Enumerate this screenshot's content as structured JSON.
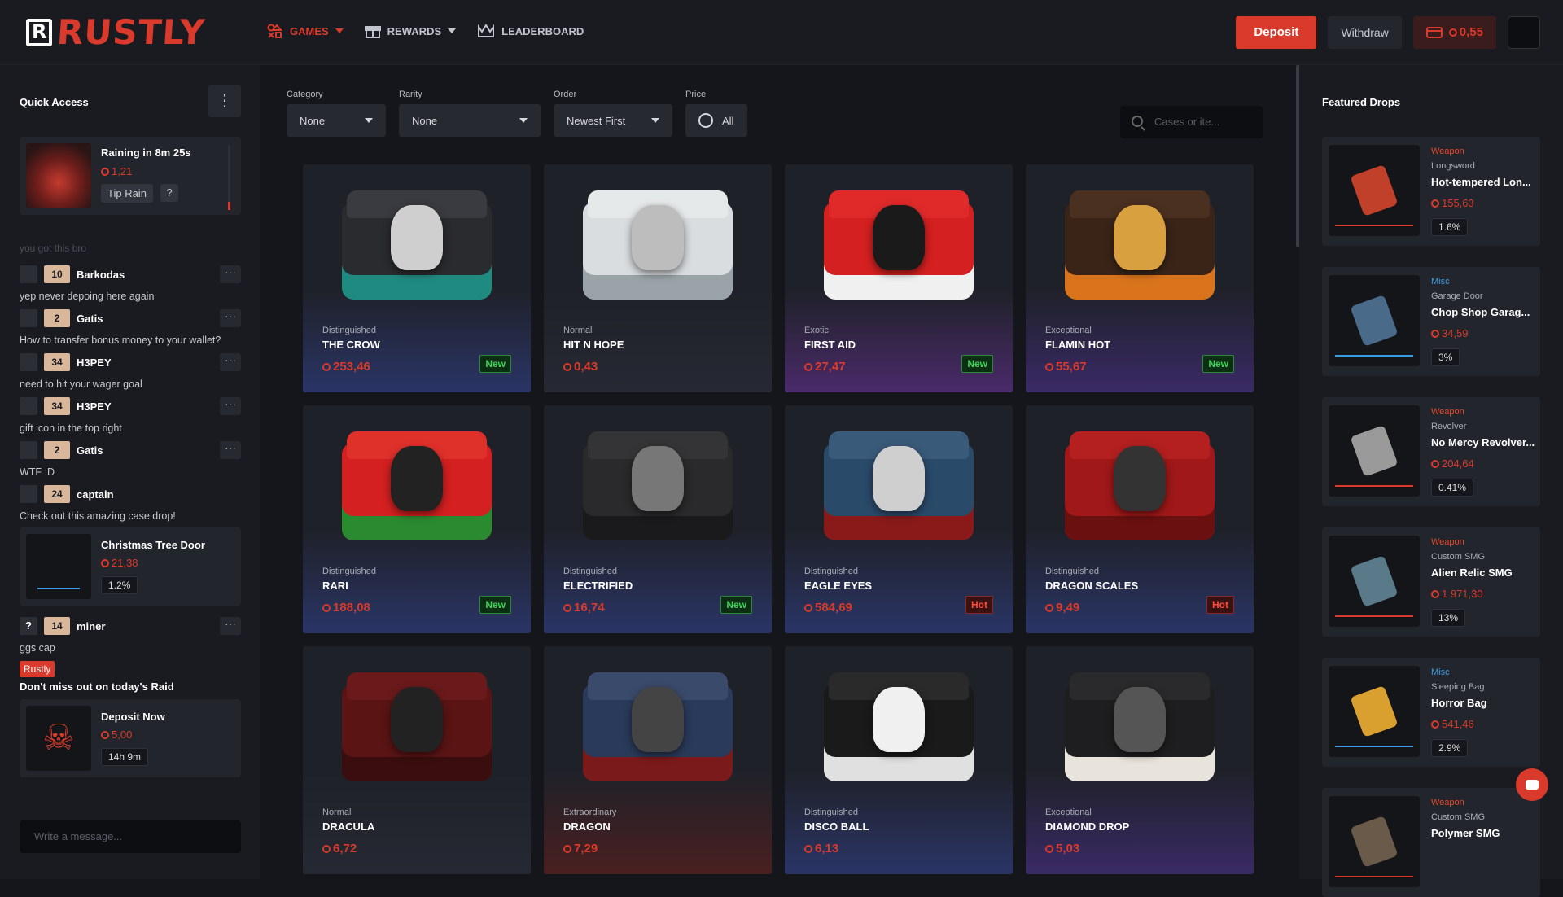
{
  "header": {
    "logo": "RUSTLY",
    "nav": [
      {
        "label": "GAMES",
        "icon": "games-icon"
      },
      {
        "label": "REWARDS",
        "icon": "gift-icon"
      },
      {
        "label": "LEADERBOARD",
        "icon": "crown-icon"
      }
    ],
    "deposit": "Deposit",
    "withdraw": "Withdraw",
    "balance": "0,55"
  },
  "sidebar": {
    "title": "Quick Access",
    "rain": {
      "title": "Raining in 8m 25s",
      "amount": "1,21",
      "tip": "Tip Rain",
      "help": "?"
    },
    "faded": "you got this bro",
    "messages": [
      {
        "user": "Barkodas",
        "level": "10",
        "text": "yep never depoing here again"
      },
      {
        "user": "Gatis",
        "level": "2",
        "text": "How to transfer bonus money to your wallet?"
      },
      {
        "user": "H3PEY",
        "level": "34",
        "text": "need to hit your wager goal"
      },
      {
        "user": "H3PEY",
        "level": "34",
        "text": "gift icon in the top right"
      },
      {
        "user": "Gatis",
        "level": "2",
        "text": "WTF :D"
      },
      {
        "user": "captain",
        "level": "24",
        "text": "Check out this amazing case drop!"
      }
    ],
    "share": {
      "title": "Christmas Tree Door",
      "amount": "21,38",
      "chance": "1.2%"
    },
    "miner": {
      "avatar": "?",
      "user": "miner",
      "level": "14",
      "text": "ggs cap"
    },
    "rustly_tag": "Rustly",
    "raid_title": "Don't miss out on today's Raid",
    "raid": {
      "title": "Deposit Now",
      "amount": "5,00",
      "timer": "14h 9m"
    },
    "input_placeholder": "Write a message..."
  },
  "filters": {
    "category": {
      "label": "Category",
      "value": "None"
    },
    "rarity": {
      "label": "Rarity",
      "value": "None"
    },
    "order": {
      "label": "Order",
      "value": "Newest First"
    },
    "price": {
      "label": "Price",
      "value": "All"
    },
    "search_placeholder": "Cases or ite..."
  },
  "cases": [
    {
      "rarity": "Distinguished",
      "name": "THE CROW",
      "price": "253,46",
      "badge": "New",
      "tint": "#2a3566",
      "body": "#2a2b2f",
      "band": "#1e8a80",
      "lid": "#3a3b40",
      "icon": "#cfcfcf"
    },
    {
      "rarity": "Normal",
      "name": "HIT N HOPE",
      "price": "0,43",
      "badge": "",
      "tint": "#262933",
      "body": "#d9dde0",
      "band": "#9aa3a8",
      "lid": "#e6e9ea",
      "icon": "#bdbdbd"
    },
    {
      "rarity": "Exotic",
      "name": "FIRST AID",
      "price": "27,47",
      "badge": "New",
      "tint": "#4a2a6a",
      "body": "#d42020",
      "band": "#f0f0f0",
      "lid": "#e02a2a",
      "icon": "#1a1a1a"
    },
    {
      "rarity": "Exceptional",
      "name": "FLAMIN HOT",
      "price": "55,67",
      "badge": "New",
      "tint": "#3a2a66",
      "body": "#3a2418",
      "band": "#d9741c",
      "lid": "#4a3020",
      "icon": "#d9a040"
    },
    {
      "rarity": "Distinguished",
      "name": "RARI",
      "price": "188,08",
      "badge": "New",
      "tint": "#2a3566",
      "body": "#d42020",
      "band": "#2a8a30",
      "lid": "#e0302a",
      "icon": "#222"
    },
    {
      "rarity": "Distinguished",
      "name": "ELECTRIFIED",
      "price": "16,74",
      "badge": "New",
      "tint": "#2a3566",
      "body": "#2a2a2c",
      "band": "#1a1a1c",
      "lid": "#343436",
      "icon": "#777"
    },
    {
      "rarity": "Distinguished",
      "name": "EAGLE EYES",
      "price": "584,69",
      "badge": "Hot",
      "tint": "#2a3566",
      "body": "#2a4a6a",
      "band": "#8a1a1a",
      "lid": "#3a5a7a",
      "icon": "#cfcfcf"
    },
    {
      "rarity": "Distinguished",
      "name": "DRAGON SCALES",
      "price": "9,49",
      "badge": "Hot",
      "tint": "#2a3566",
      "body": "#a01818",
      "band": "#6a1010",
      "lid": "#b42020",
      "icon": "#333"
    },
    {
      "rarity": "Normal",
      "name": "DRACULA",
      "price": "6,72",
      "badge": "",
      "tint": "#262933",
      "body": "#5a1414",
      "band": "#3a0e0e",
      "lid": "#6a1a1a",
      "icon": "#222"
    },
    {
      "rarity": "Extraordinary",
      "name": "DRAGON",
      "price": "7,29",
      "badge": "",
      "tint": "#4a2020",
      "body": "#2a3a5a",
      "band": "#7a1a1a",
      "lid": "#3a4a6a",
      "icon": "#444"
    },
    {
      "rarity": "Distinguished",
      "name": "DISCO BALL",
      "price": "6,13",
      "badge": "",
      "tint": "#2a3566",
      "body": "#1a1a1a",
      "band": "#e0e0e0",
      "lid": "#2a2a2a",
      "icon": "#f0f0f0"
    },
    {
      "rarity": "Exceptional",
      "name": "DIAMOND DROP",
      "price": "5,03",
      "badge": "",
      "tint": "#3a2a66",
      "body": "#1e1e20",
      "band": "#e8e4dc",
      "lid": "#2a2a2c",
      "icon": "#555"
    }
  ],
  "featured": {
    "title": "Featured Drops",
    "drops": [
      {
        "category": "Weapon",
        "cat_color": "#e04a2a",
        "type": "Longsword",
        "name": "Hot-tempered Lon...",
        "price": "155,63",
        "chance": "1.6%",
        "line": "#d93a2b",
        "obj": "#c0402a"
      },
      {
        "category": "Misc",
        "cat_color": "#3a9be0",
        "type": "Garage Door",
        "name": "Chop Shop Garag...",
        "price": "34,59",
        "chance": "3%",
        "line": "#3a9be0",
        "obj": "#4a6a8a"
      },
      {
        "category": "Weapon",
        "cat_color": "#e04a2a",
        "type": "Revolver",
        "name": "No Mercy Revolver...",
        "price": "204,64",
        "chance": "0.41%",
        "line": "#d93a2b",
        "obj": "#9a9a9a"
      },
      {
        "category": "Weapon",
        "cat_color": "#e04a2a",
        "type": "Custom SMG",
        "name": "Alien Relic SMG",
        "price": "1 971,30",
        "chance": "13%",
        "line": "#d93a2b",
        "obj": "#5a7a8a"
      },
      {
        "category": "Misc",
        "cat_color": "#3a9be0",
        "type": "Sleeping Bag",
        "name": "Horror Bag",
        "price": "541,46",
        "chance": "2.9%",
        "line": "#3a9be0",
        "obj": "#d9a030"
      },
      {
        "category": "Weapon",
        "cat_color": "#e04a2a",
        "type": "Custom SMG",
        "name": "Polymer SMG",
        "price": "",
        "chance": "",
        "line": "#d93a2b",
        "obj": "#6a5a4a"
      }
    ]
  }
}
